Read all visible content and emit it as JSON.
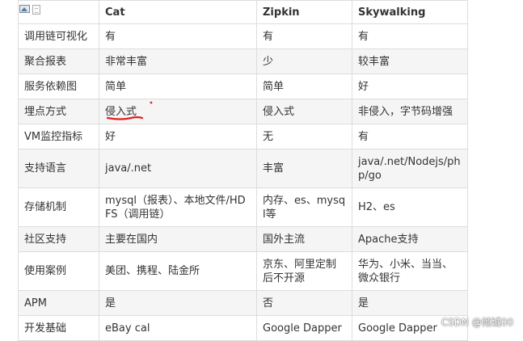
{
  "headers": [
    "",
    "Cat",
    "Zipkin",
    "Skywalking"
  ],
  "rows": [
    [
      "调用链可视化",
      "有",
      "有",
      "有"
    ],
    [
      "聚合报表",
      "非常丰富",
      "少",
      "较丰富"
    ],
    [
      "服务依赖图",
      "简单",
      "简单",
      "好"
    ],
    [
      "埋点方式",
      "侵入式",
      "侵入式",
      "非侵入，字节码增强"
    ],
    [
      "VM监控指标",
      "好",
      "无",
      "有"
    ],
    [
      "支持语言",
      "java/.net",
      "丰富",
      "java/.net/Nodejs/php/go"
    ],
    [
      "存储机制",
      "mysql（报表）、本地文件/HDFS（调用链）",
      "内存、es、mysql等",
      "H2、es"
    ],
    [
      "社区支持",
      "主要在国内",
      "国外主流",
      "Apache支持"
    ],
    [
      "使用案例",
      "美团、携程、陆金所",
      "京东、阿里定制后不开源",
      "华为、小米、当当、微众银行"
    ],
    [
      "APM",
      "是",
      "否",
      "是"
    ],
    [
      "开发基础",
      "eBay cal",
      "Google Dapper",
      "Google Dapper"
    ]
  ],
  "watermark": "CSDN @倾城00",
  "annotation_color": "#e02020"
}
